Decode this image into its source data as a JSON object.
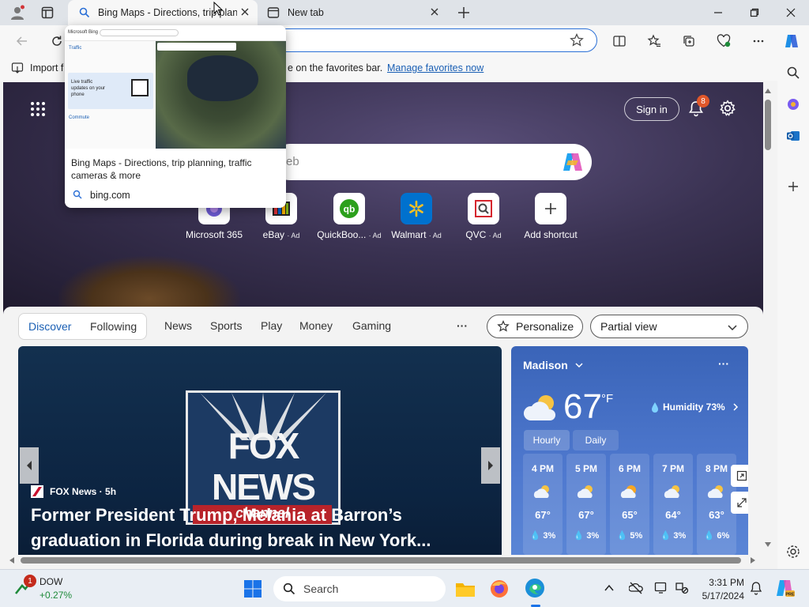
{
  "browser": {
    "tabs": [
      {
        "title": "Bing Maps - Directions, trip plann",
        "active": true
      },
      {
        "title": "New tab",
        "active": false
      }
    ],
    "favorites_bar": {
      "import_label": "Import f",
      "message_tail": "e on the favorites bar.",
      "manage_link": "Manage favorites now"
    }
  },
  "tab_preview": {
    "title": "Bing Maps - Directions, trip planning, traffic cameras & more",
    "domain": "bing.com",
    "thumb_header": "Microsoft Bing",
    "thumb_section": "Traffic",
    "thumb_promo": "Live traffic updates on your phone",
    "thumb_commute": "Commute"
  },
  "newtab": {
    "sign_in_label": "Sign in",
    "notification_count": "8",
    "search_placeholder": "eb",
    "shortcuts": [
      {
        "label": "Microsoft 365",
        "ad": ""
      },
      {
        "label": "eBay",
        "ad": "· Ad"
      },
      {
        "label": "QuickBoo...",
        "ad": "· Ad"
      },
      {
        "label": "Walmart",
        "ad": "· Ad"
      },
      {
        "label": "QVC",
        "ad": "· Ad"
      },
      {
        "label": "Add shortcut",
        "ad": ""
      }
    ]
  },
  "feed": {
    "tabs": {
      "discover": "Discover",
      "following": "Following"
    },
    "nav": [
      "News",
      "Sports",
      "Play",
      "Money",
      "Gaming"
    ],
    "more_label": "···",
    "personalize_label": "Personalize",
    "view_label": "Partial view",
    "news": {
      "source": "FOX News · 5h",
      "headline": "Former President Trump, Melania at Barron’s graduation in Florida during break in New York...",
      "logo_line1": "FOX",
      "logo_line2": "NEWS",
      "logo_line3": "channel"
    },
    "weather": {
      "location": "Madison",
      "temperature": "67",
      "unit": "°F",
      "humidity": "Humidity 73%",
      "tabs": [
        "Hourly",
        "Daily"
      ],
      "hours": [
        {
          "time": "4 PM",
          "temp": "67°",
          "precip": "3%"
        },
        {
          "time": "5 PM",
          "temp": "67°",
          "precip": "3%"
        },
        {
          "time": "6 PM",
          "temp": "65°",
          "precip": "5%"
        },
        {
          "time": "7 PM",
          "temp": "64°",
          "precip": "3%"
        },
        {
          "time": "8 PM",
          "temp": "63°",
          "precip": "6%"
        }
      ]
    }
  },
  "taskbar": {
    "stock_name": "DOW",
    "stock_change": "+0.27%",
    "stock_badge": "1",
    "search_label": "Search",
    "time": "3:31 PM",
    "date": "5/17/2024"
  },
  "colors": {
    "accent": "#2a6fd6",
    "link": "#1a5fb4",
    "weather_bg": "#4a74c9",
    "news_bg": "#0c2441",
    "notification_badge": "#e0572a"
  }
}
